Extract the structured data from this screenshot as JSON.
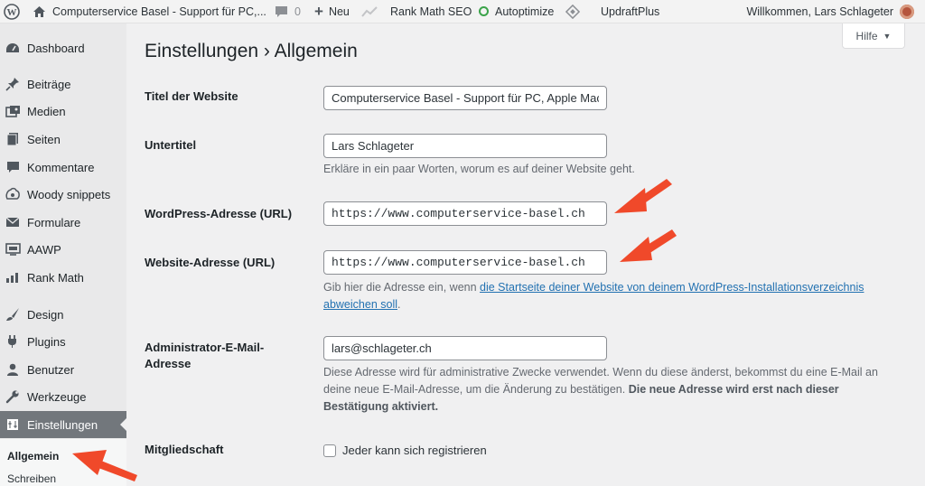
{
  "adminbar": {
    "site_name": "Computerservice Basel - Support für PC,...",
    "comments_count": "0",
    "new_label": "Neu",
    "rankmath_label": "Rank Math SEO",
    "autoptimize_label": "Autoptimize",
    "updraft_label": "UpdraftPlus",
    "welcome": "Willkommen, Lars Schlageter"
  },
  "sidebar": {
    "items": [
      {
        "label": "Dashboard",
        "icon": "dashboard-icon"
      },
      {
        "label": "Beiträge",
        "icon": "pin-icon"
      },
      {
        "label": "Medien",
        "icon": "media-icon"
      },
      {
        "label": "Seiten",
        "icon": "page-icon"
      },
      {
        "label": "Kommentare",
        "icon": "comment-icon"
      },
      {
        "label": "Woody snippets",
        "icon": "snippets-icon"
      },
      {
        "label": "Formulare",
        "icon": "mail-icon"
      },
      {
        "label": "AAWP",
        "icon": "aawp-icon"
      },
      {
        "label": "Rank Math",
        "icon": "rankmath-icon"
      },
      {
        "label": "Design",
        "icon": "brush-icon"
      },
      {
        "label": "Plugins",
        "icon": "plugin-icon"
      },
      {
        "label": "Benutzer",
        "icon": "user-icon"
      },
      {
        "label": "Werkzeuge",
        "icon": "wrench-icon"
      },
      {
        "label": "Einstellungen",
        "icon": "settings-icon"
      }
    ],
    "submenu": [
      "Allgemein",
      "Schreiben"
    ]
  },
  "help_label": "Hilfe",
  "page_title": "Einstellungen › Allgemein",
  "form": {
    "site_title_label": "Titel der Website",
    "site_title_value": "Computerservice Basel - Support für PC, Apple Mac",
    "tagline_label": "Untertitel",
    "tagline_value": "Lars Schlageter",
    "tagline_desc": "Erkläre in ein paar Worten, worum es auf deiner Website geht.",
    "wp_url_label": "WordPress-Adresse (URL)",
    "wp_url_value": "https://www.computerservice-basel.ch",
    "site_url_label": "Website-Adresse (URL)",
    "site_url_value": "https://www.computerservice-basel.ch",
    "site_url_desc_prefix": "Gib hier die Adresse ein, wenn ",
    "site_url_desc_link": "die Startseite deiner Website von deinem WordPress-Installationsverzeichnis abweichen soll",
    "site_url_desc_suffix": ".",
    "email_label": "Administrator-E-Mail-Adresse",
    "email_value": "lars@schlageter.ch",
    "email_desc": "Diese Adresse wird für administrative Zwecke verwendet. Wenn du diese änderst, bekommst du eine E-Mail an deine neue E-Mail-Adresse, um die Änderung zu bestätigen. ",
    "email_desc_bold": "Die neue Adresse wird erst nach dieser Bestätigung aktiviert.",
    "membership_label": "Mitgliedschaft",
    "membership_checkbox": "Jeder kann sich registrieren"
  },
  "colors": {
    "accent": "#2271b1",
    "arrow": "#f0492a",
    "current_menu": "#72777c"
  }
}
